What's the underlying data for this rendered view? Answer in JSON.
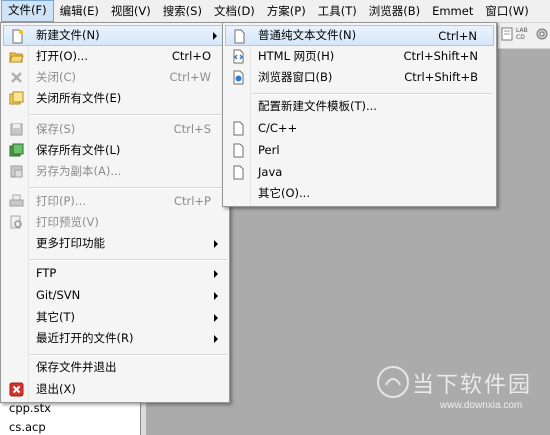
{
  "menubar": [
    "文件(F)",
    "编辑(E)",
    "视图(V)",
    "搜索(S)",
    "文档(D)",
    "方案(P)",
    "工具(T)",
    "浏览器(B)",
    "Emmet",
    "窗口(W)"
  ],
  "file_menu": {
    "new": {
      "label": "新建文件(N)"
    },
    "open": {
      "label": "打开(O)...",
      "shortcut": "Ctrl+O"
    },
    "close": {
      "label": "关闭(C)",
      "shortcut": "Ctrl+W"
    },
    "close_all": {
      "label": "关闭所有文件(E)"
    },
    "save": {
      "label": "保存(S)",
      "shortcut": "Ctrl+S"
    },
    "save_all": {
      "label": "保存所有文件(L)"
    },
    "save_copy": {
      "label": "另存为副本(A)..."
    },
    "print": {
      "label": "打印(P)...",
      "shortcut": "Ctrl+P"
    },
    "print_preview": {
      "label": "打印预览(V)"
    },
    "more_print": {
      "label": "更多打印功能"
    },
    "ftp": {
      "label": "FTP"
    },
    "git": {
      "label": "Git/SVN"
    },
    "other": {
      "label": "其它(T)"
    },
    "recent": {
      "label": "最近打开的文件(R)"
    },
    "save_exit": {
      "label": "保存文件并退出"
    },
    "exit": {
      "label": "退出(X)"
    }
  },
  "new_submenu": {
    "plain": {
      "label": "普通纯文本文件(N)",
      "shortcut": "Ctrl+N"
    },
    "html": {
      "label": "HTML 网页(H)",
      "shortcut": "Ctrl+Shift+N"
    },
    "browser": {
      "label": "浏览器窗口(B)",
      "shortcut": "Ctrl+Shift+B"
    },
    "template": {
      "label": "配置新建文件模板(T)..."
    },
    "cpp": {
      "label": "C/C++"
    },
    "perl": {
      "label": "Perl"
    },
    "java": {
      "label": "Java"
    },
    "other": {
      "label": "其它(O)..."
    }
  },
  "file_list": [
    "cpp.stx",
    "cs.acp"
  ],
  "watermark": {
    "text": "当下软件园",
    "url": "www.downxia.com"
  },
  "toolbar_right": {
    "label": "LAB CD"
  },
  "colors": {
    "highlight": "#d5e7f9",
    "highlight_border": "#a8c8ea",
    "disabled": "#8c8c8c"
  }
}
